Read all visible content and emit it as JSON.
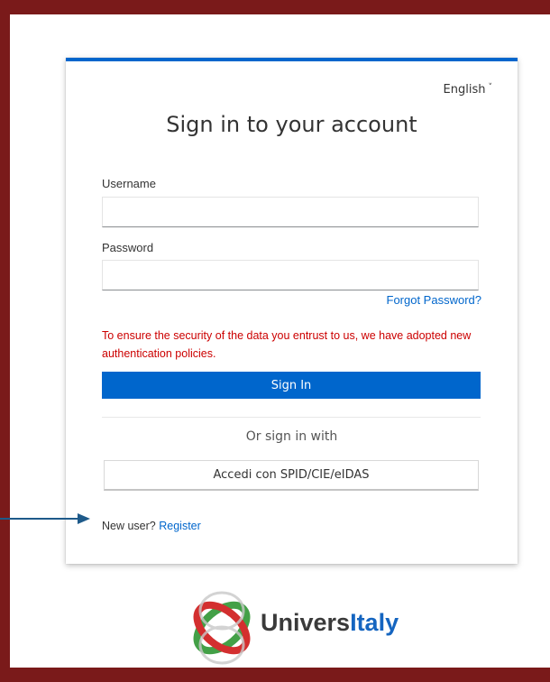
{
  "language": {
    "current": "English",
    "caret": "˅"
  },
  "form": {
    "title": "Sign in to your account",
    "username_label": "Username",
    "username_value": "",
    "password_label": "Password",
    "password_value": "",
    "forgot_password": "Forgot Password?",
    "security_notice": "To ensure the security of the data you entrust to us, we have adopted new authentication policies.",
    "sign_in_button": "Sign In",
    "or_sign_in_with": "Or sign in with",
    "spid_button": "Accedi con SPID/CIE/eIDAS",
    "new_user_prefix": "New user?",
    "register_link": "Register"
  },
  "brand": {
    "logo_name_part1": "Univers",
    "logo_name_part2": "Italy"
  },
  "colors": {
    "accent_blue": "#0066cc",
    "frame_maroon": "#7a1a1a",
    "notice_red": "#cc0000",
    "logo_red": "#d32f2f",
    "logo_green": "#43a047",
    "arrow": "#1e5a8a"
  },
  "annotation": {
    "arrow_icon": "arrow-right-icon"
  }
}
